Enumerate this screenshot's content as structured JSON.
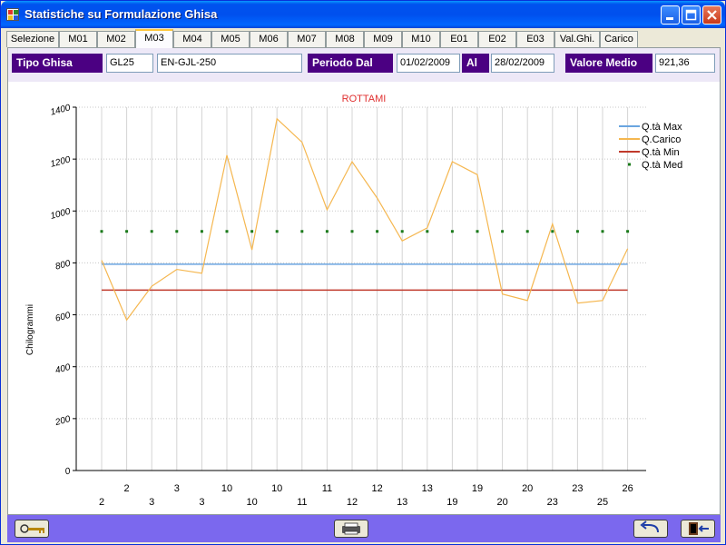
{
  "window": {
    "title": "Statistiche su Formulazione Ghisa",
    "controls": [
      "minimize-icon",
      "maximize-icon",
      "close-icon"
    ]
  },
  "tabs": [
    {
      "label": "Selezione"
    },
    {
      "label": "M01"
    },
    {
      "label": "M02"
    },
    {
      "label": "M03",
      "active": true
    },
    {
      "label": "M04"
    },
    {
      "label": "M05"
    },
    {
      "label": "M06"
    },
    {
      "label": "M07"
    },
    {
      "label": "M08"
    },
    {
      "label": "M09"
    },
    {
      "label": "M10"
    },
    {
      "label": "E01"
    },
    {
      "label": "E02"
    },
    {
      "label": "E03"
    },
    {
      "label": "Val.Ghi."
    },
    {
      "label": "Carico"
    }
  ],
  "filters": {
    "tipo_ghisa_label": "Tipo Ghisa",
    "tipo_ghisa_code": "GL25",
    "tipo_ghisa_desc": "EN-GJL-250",
    "periodo_dal_label": "Periodo Dal",
    "periodo_dal_value": "01/02/2009",
    "al_label": "Al",
    "al_value": "28/02/2009",
    "valore_medio_label": "Valore Medio",
    "valore_medio_value": "921,36"
  },
  "colors": {
    "accent_purple": "#4b0082",
    "bottom_bar": "#7b68ee",
    "max_line": "#6aa5e0",
    "carico_line": "#f5b750",
    "min_line": "#c0392b",
    "med_dots": "#1a7a1a",
    "chart_title": "#e03030"
  },
  "chart_data": {
    "type": "line",
    "title": "ROTTAMI",
    "ylabel": "Chilogrammi",
    "xlabel": "",
    "ylim": [
      0,
      1400
    ],
    "yticks": [
      0,
      200,
      400,
      600,
      800,
      1000,
      1200,
      1400
    ],
    "grid": true,
    "legend_position": "top-right",
    "x_labels_top": [
      "",
      "2",
      "",
      "3",
      "",
      "10",
      "",
      "10",
      "",
      "11",
      "",
      "12",
      "",
      "13",
      "",
      "19",
      "",
      "20",
      "",
      "23",
      "",
      "26"
    ],
    "x_labels_bottom": [
      "2",
      "",
      "3",
      "",
      "3",
      "",
      "10",
      "",
      "11",
      "",
      "12",
      "",
      "13",
      "",
      "19",
      "",
      "20",
      "",
      "23",
      "",
      "25",
      ""
    ],
    "series": [
      {
        "name": "Q.tà Max",
        "style": "line",
        "values": [
          795,
          795,
          795,
          795,
          795,
          795,
          795,
          795,
          795,
          795,
          795,
          795,
          795,
          795,
          795,
          795,
          795,
          795,
          795,
          795,
          795,
          795
        ]
      },
      {
        "name": "Q.Carico",
        "style": "line",
        "values": [
          810,
          580,
          710,
          775,
          760,
          1215,
          850,
          1355,
          1265,
          1005,
          1190,
          1050,
          885,
          935,
          1190,
          1140,
          680,
          655,
          950,
          645,
          655,
          855
        ]
      },
      {
        "name": "Q.tà Min",
        "style": "line",
        "values": [
          695,
          695,
          695,
          695,
          695,
          695,
          695,
          695,
          695,
          695,
          695,
          695,
          695,
          695,
          695,
          695,
          695,
          695,
          695,
          695,
          695,
          695
        ]
      },
      {
        "name": "Q.tà Med",
        "style": "dots",
        "values": [
          921.36,
          921.36,
          921.36,
          921.36,
          921.36,
          921.36,
          921.36,
          921.36,
          921.36,
          921.36,
          921.36,
          921.36,
          921.36,
          921.36,
          921.36,
          921.36,
          921.36,
          921.36,
          921.36,
          921.36,
          921.36,
          921.36
        ]
      }
    ]
  },
  "bottom_buttons": [
    {
      "icon": "key-icon"
    },
    {
      "icon": "printer-icon"
    },
    {
      "icon": "undo-arrow-icon"
    },
    {
      "icon": "exit-door-icon"
    }
  ]
}
